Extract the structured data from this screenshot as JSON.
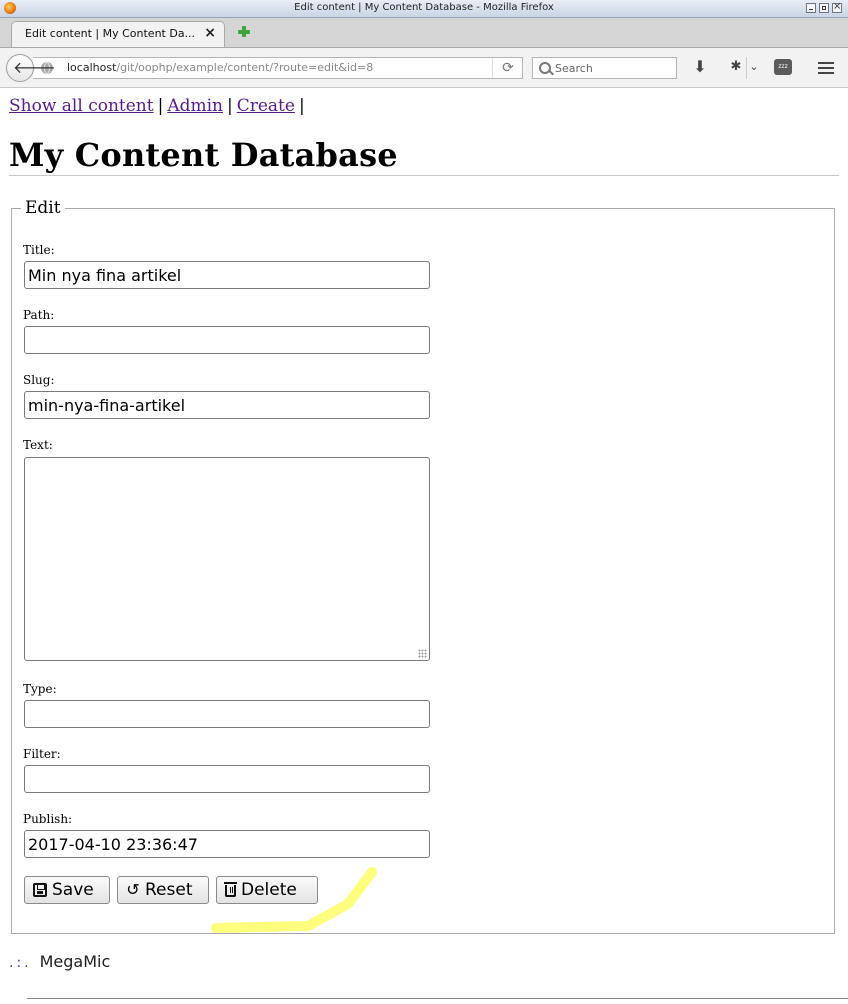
{
  "window": {
    "title": "Edit content | My Content Database - Mozilla Firefox"
  },
  "browser": {
    "tab_title": "Edit content | My Content Da...",
    "tab_close": "×",
    "url_host": "localhost",
    "url_path": "/git/oophp/example/content/?route=edit&id=8",
    "search_placeholder": "Search",
    "icons": [
      "firefox-icon",
      "back-arrow-icon",
      "globe-icon",
      "reload-icon",
      "search-icon",
      "download-icon",
      "addon-icon",
      "chevron-down-icon",
      "sleep-icon",
      "hamburger-menu-icon",
      "new-tab-icon"
    ]
  },
  "nav": {
    "show_all": "Show all content",
    "admin": "Admin",
    "create": "Create",
    "sep": "|"
  },
  "page": {
    "title": "My Content Database"
  },
  "form": {
    "legend": "Edit",
    "title_label": "Title:",
    "title_value": "Min nya fina artikel",
    "path_label": "Path:",
    "path_value": "",
    "slug_label": "Slug:",
    "slug_value": "min-nya-fina-artikel",
    "text_label": "Text:",
    "text_value": "",
    "type_label": "Type:",
    "type_value": "",
    "filter_label": "Filter:",
    "filter_value": "",
    "publish_label": "Publish:",
    "publish_value": "2017-04-10 23:36:47",
    "save_label": "Save",
    "reset_label": "Reset",
    "delete_label": "Delete"
  },
  "footer": {
    "dots": ".:.",
    "text": "MegaMic"
  },
  "colors": {
    "link": "#551a8b",
    "highlight": "#ffff66"
  }
}
